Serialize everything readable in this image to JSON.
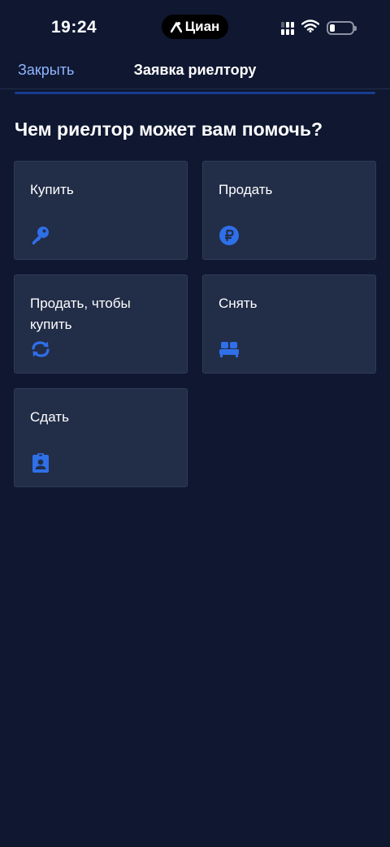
{
  "status_bar": {
    "time": "19:24",
    "app_pill": "Циан"
  },
  "nav": {
    "close_label": "Закрыть",
    "title": "Заявка риелтору"
  },
  "heading": "Чем риелтор может вам помочь?",
  "options": [
    {
      "label": "Купить",
      "icon": "key-icon"
    },
    {
      "label": "Продать",
      "icon": "ruble-icon"
    },
    {
      "label": "Продать, чтобы купить",
      "icon": "exchange-icon"
    },
    {
      "label": "Снять",
      "icon": "sofa-icon"
    },
    {
      "label": "Сдать",
      "icon": "badge-icon"
    }
  ],
  "colors": {
    "background": "#0f1731",
    "card": "#222d48",
    "accent": "#2f6fe8",
    "link": "#8fb6ff"
  }
}
